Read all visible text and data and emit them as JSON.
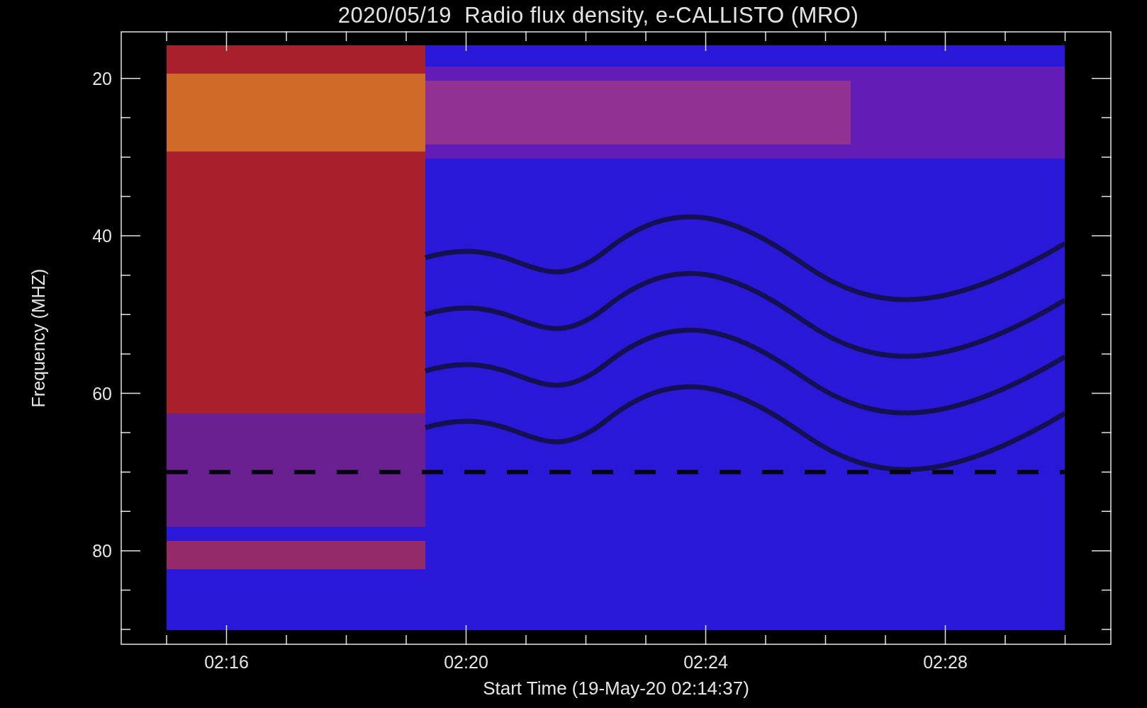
{
  "title": "2020/05/19  Radio flux density, e-CALLISTO (MRO)",
  "y_axis": {
    "label": "Frequency (MHZ)",
    "ticks": [
      "20",
      "40",
      "60",
      "80"
    ]
  },
  "x_axis": {
    "label": "Start Time (19-May-20 02:14:37)",
    "ticks": [
      "02:16",
      "02:20",
      "02:24",
      "02:28"
    ]
  }
}
